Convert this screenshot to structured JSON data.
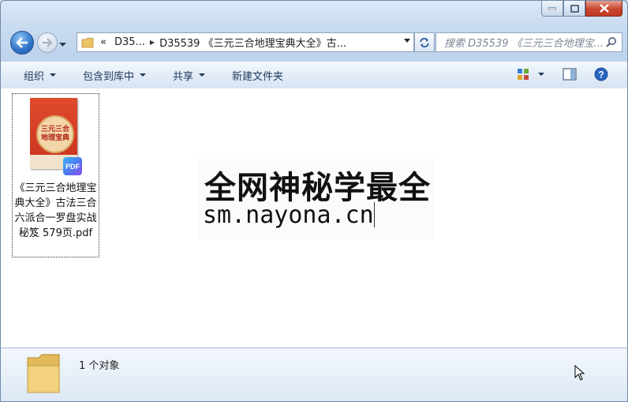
{
  "window": {
    "caption_buttons": [
      "minimize",
      "maximize",
      "close"
    ]
  },
  "nav": {
    "address_overflow": "«",
    "address_segment1": "D35...",
    "address_segment2": "D35539 《三元三合地理宝典大全》古...",
    "search_placeholder": "搜索 D35539 《三元三合地理宝..."
  },
  "toolbar": {
    "organize": "组织",
    "include_in_library": "包含到库中",
    "share": "共享",
    "new_folder": "新建文件夹"
  },
  "files": [
    {
      "name": "《三元三合地理宝典大全》古法三合六派合一罗盘实战秘笈 579页.pdf",
      "type": "pdf",
      "thumb_title": "三元三合地理宝典",
      "badge": "PDF"
    }
  ],
  "watermark": {
    "line1": "全网神秘学最全",
    "line2": "sm.nayona.cn"
  },
  "details": {
    "count_text": "1 个对象"
  },
  "colors": {
    "accent": "#1e395b",
    "close_button": "#c7452d",
    "thumb_red": "#d63d26"
  }
}
